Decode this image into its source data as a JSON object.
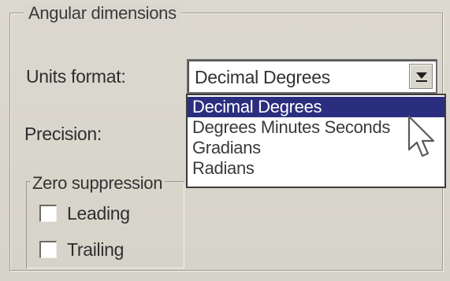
{
  "angular_group": {
    "title": "Angular dimensions"
  },
  "units_format": {
    "label": "Units format:",
    "selected_value": "Decimal Degrees",
    "options": [
      "Decimal Degrees",
      "Degrees Minutes Seconds",
      "Gradians",
      "Radians"
    ],
    "highlighted_index": 0
  },
  "precision": {
    "label": "Precision:"
  },
  "zero_suppression": {
    "title": "Zero suppression",
    "leading_label": "Leading",
    "leading_checked": false,
    "trailing_label": "Trailing",
    "trailing_checked": false
  },
  "colors": {
    "selection": "#2b2e7e",
    "panel": "#d9d6cc"
  },
  "icons": {
    "dropdown_arrow": "chevron-down-icon",
    "cursor": "mouse-pointer-icon"
  }
}
